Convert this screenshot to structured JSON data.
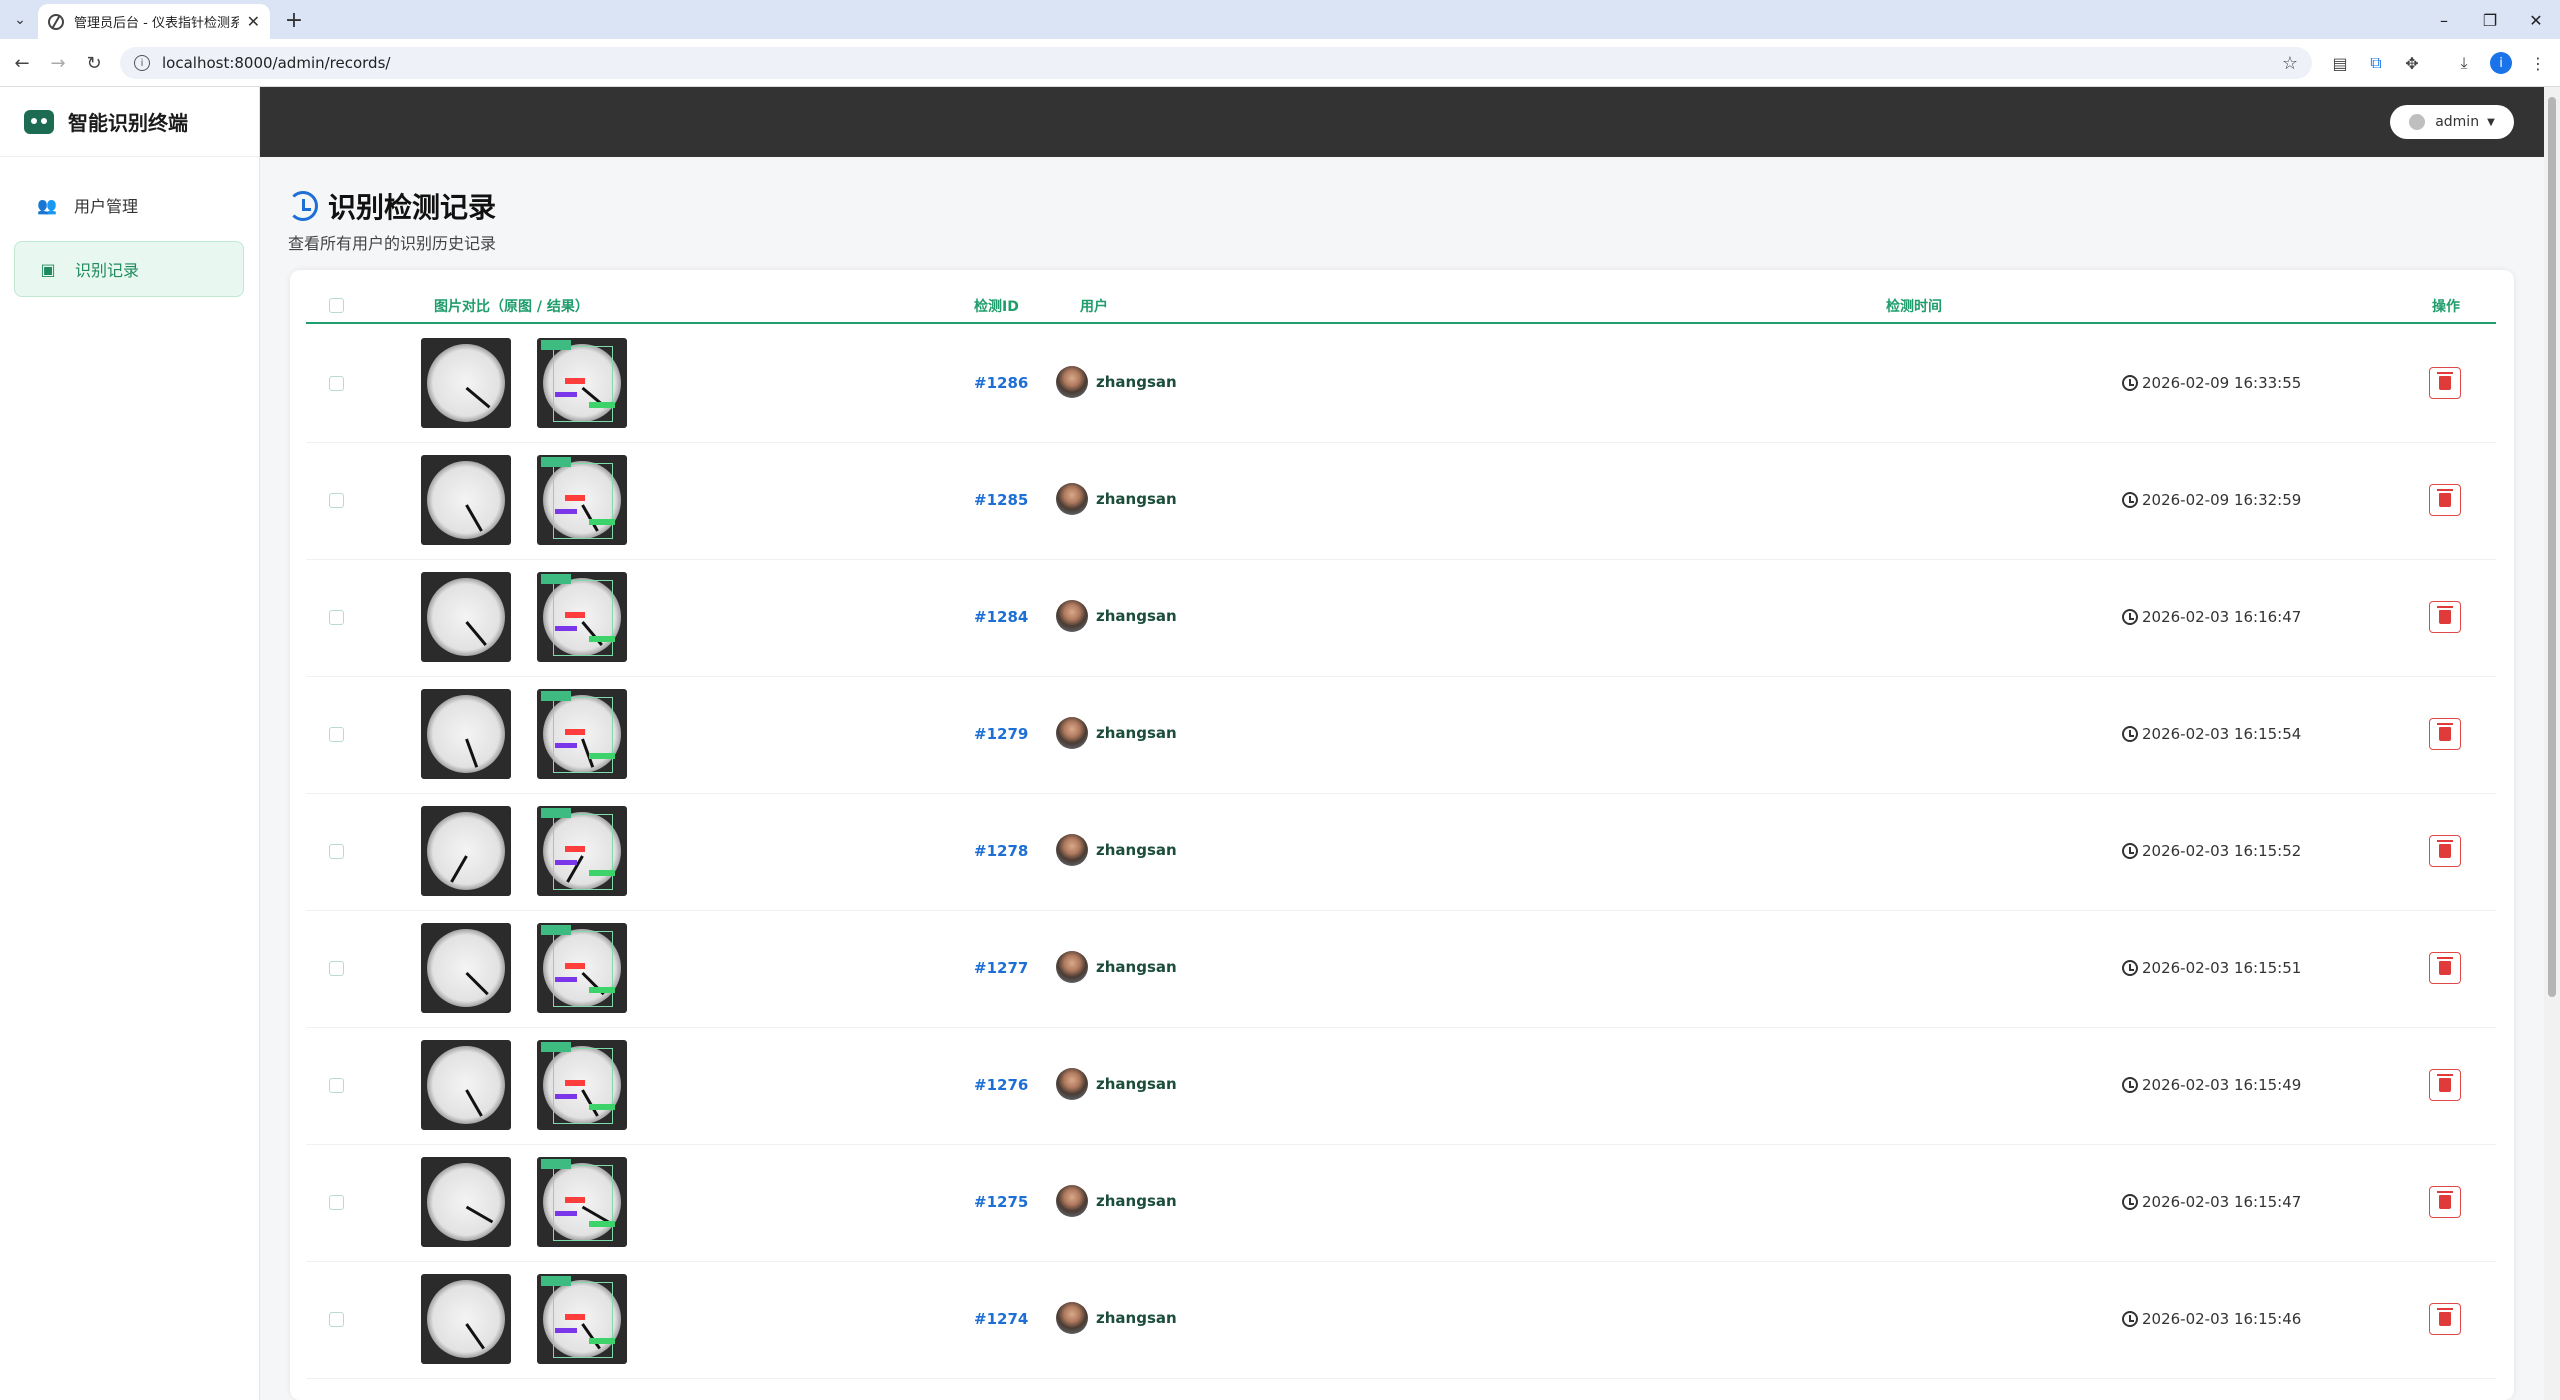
{
  "browser": {
    "tab_title": "管理员后台 - 仪表指针检测系统",
    "url": "localhost:8000/admin/records/",
    "profile_initial": "i"
  },
  "app": {
    "brand": "智能识别终端",
    "nav": [
      {
        "label": "用户管理",
        "icon": "users-icon"
      },
      {
        "label": "识别记录",
        "icon": "clipboard-check-icon",
        "active": true
      }
    ],
    "user_menu": {
      "label": "admin"
    }
  },
  "page": {
    "title": "识别检测记录",
    "subtitle": "查看所有用户的识别历史记录"
  },
  "table": {
    "headers": {
      "images": "图片对比（原图 / 结果）",
      "id": "检测ID",
      "user": "用户",
      "time": "检测时间",
      "actions": "操作"
    },
    "rows": [
      {
        "id": "#1286",
        "user": "zhangsan",
        "time": "2026-02-09 16:33:55"
      },
      {
        "id": "#1285",
        "user": "zhangsan",
        "time": "2026-02-09 16:32:59"
      },
      {
        "id": "#1284",
        "user": "zhangsan",
        "time": "2026-02-03 16:16:47"
      },
      {
        "id": "#1279",
        "user": "zhangsan",
        "time": "2026-02-03 16:15:54"
      },
      {
        "id": "#1278",
        "user": "zhangsan",
        "time": "2026-02-03 16:15:52"
      },
      {
        "id": "#1277",
        "user": "zhangsan",
        "time": "2026-02-03 16:15:51"
      },
      {
        "id": "#1276",
        "user": "zhangsan",
        "time": "2026-02-03 16:15:49"
      },
      {
        "id": "#1275",
        "user": "zhangsan",
        "time": "2026-02-03 16:15:47"
      },
      {
        "id": "#1274",
        "user": "zhangsan",
        "time": "2026-02-03 16:15:46"
      }
    ]
  },
  "colors": {
    "accent": "#1f9d6c",
    "link": "#1d6fd6",
    "danger": "#e03a3a",
    "topbar": "#333333"
  }
}
